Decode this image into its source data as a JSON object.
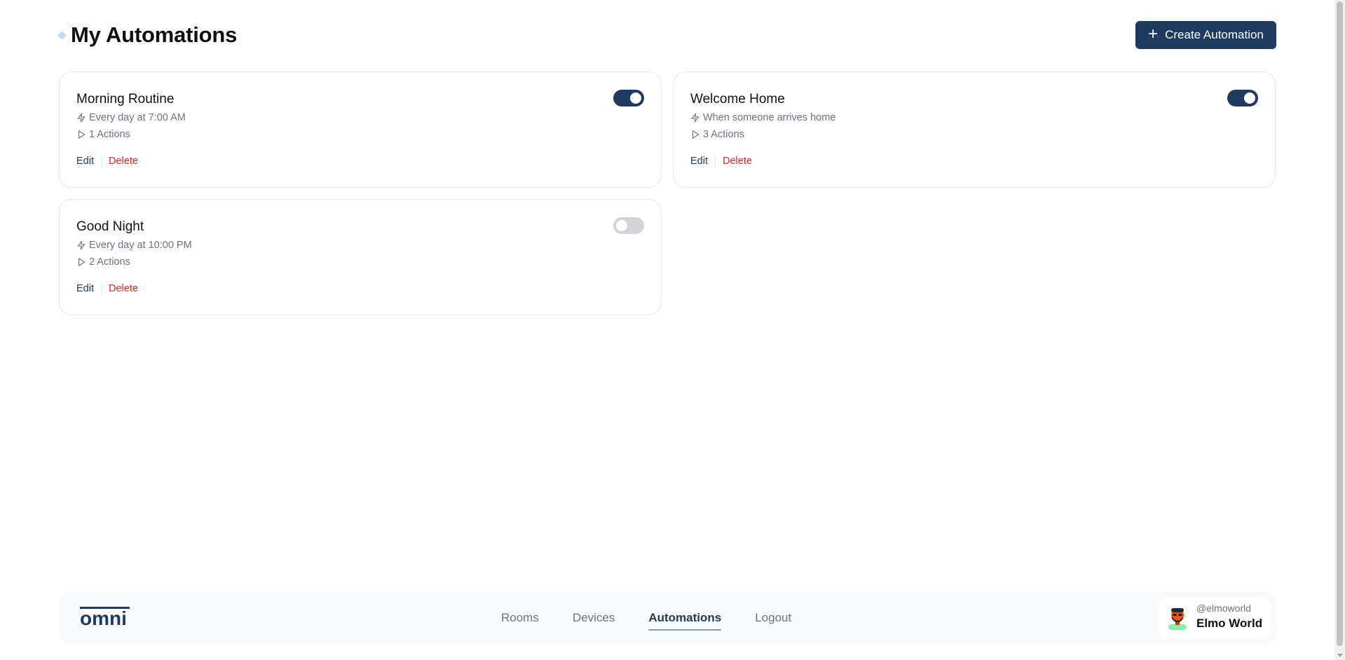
{
  "header": {
    "title": "My Automations",
    "create_label": "Create Automation"
  },
  "automations": [
    {
      "name": "Morning Routine",
      "trigger": "Every day at 7:00 AM",
      "actions": "1 Actions",
      "enabled": true,
      "edit_label": "Edit",
      "delete_label": "Delete"
    },
    {
      "name": "Welcome Home",
      "trigger": "When someone arrives home",
      "actions": "3 Actions",
      "enabled": true,
      "edit_label": "Edit",
      "delete_label": "Delete"
    },
    {
      "name": "Good Night",
      "trigger": "Every day at 10:00 PM",
      "actions": "2 Actions",
      "enabled": false,
      "edit_label": "Edit",
      "delete_label": "Delete"
    }
  ],
  "footer": {
    "logo_text": "omni",
    "nav": [
      {
        "label": "Rooms",
        "active": false
      },
      {
        "label": "Devices",
        "active": false
      },
      {
        "label": "Automations",
        "active": true
      },
      {
        "label": "Logout",
        "active": false
      }
    ],
    "user": {
      "handle": "@elmoworld",
      "name": "Elmo World"
    }
  },
  "icons": {
    "title_marker": "diamond-icon",
    "create": "plus-icon",
    "trigger": "lightning-icon",
    "actions": "play-icon",
    "avatar": "avatar-icon"
  },
  "colors": {
    "primary": "#1e3a5f",
    "danger": "#dc2626",
    "muted": "#6b7280",
    "toggle_off": "#d4d4d8"
  }
}
